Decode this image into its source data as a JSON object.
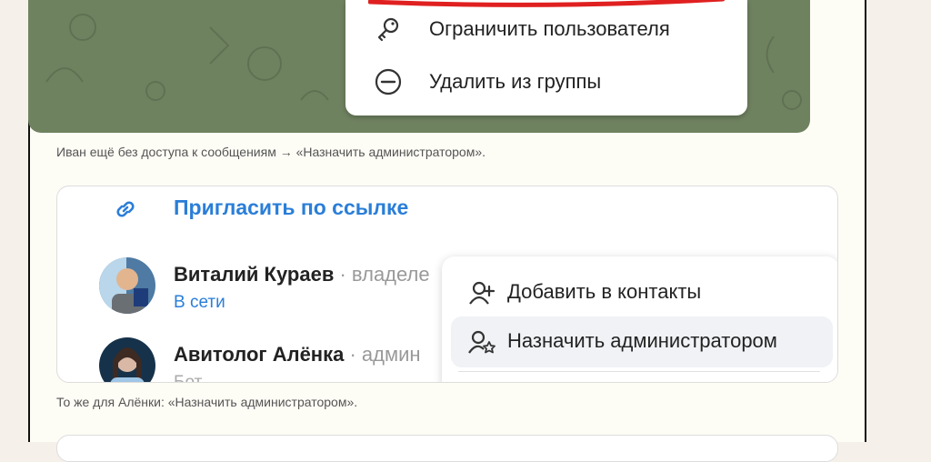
{
  "top_menu": {
    "items": [
      {
        "label": "Ограничить пользователя",
        "icon": "key-icon"
      },
      {
        "label": "Удалить из группы",
        "icon": "minus-circle-icon"
      }
    ],
    "highlight_color": "#e02020"
  },
  "captions": {
    "first": "Иван ещё без доступа к сообщениям → «Назначить администратором».",
    "second": "То же для Алёнки: «Назначить администратором»."
  },
  "group_panel": {
    "invite_label": "Пригласить по ссылке",
    "members": [
      {
        "name": "Виталий Кураев",
        "role": " · владеле",
        "status": "В сети"
      },
      {
        "name": "Авитолог Алёнка",
        "role": " · админ",
        "status": "Бот"
      }
    ],
    "context_menu": [
      {
        "label": "Добавить в контакты",
        "icon": "add-user-icon"
      },
      {
        "label": "Назначить администратором",
        "icon": "admin-star-icon"
      }
    ]
  },
  "colors": {
    "accent": "#2a7ed8",
    "chat_background": "#6f8260"
  }
}
